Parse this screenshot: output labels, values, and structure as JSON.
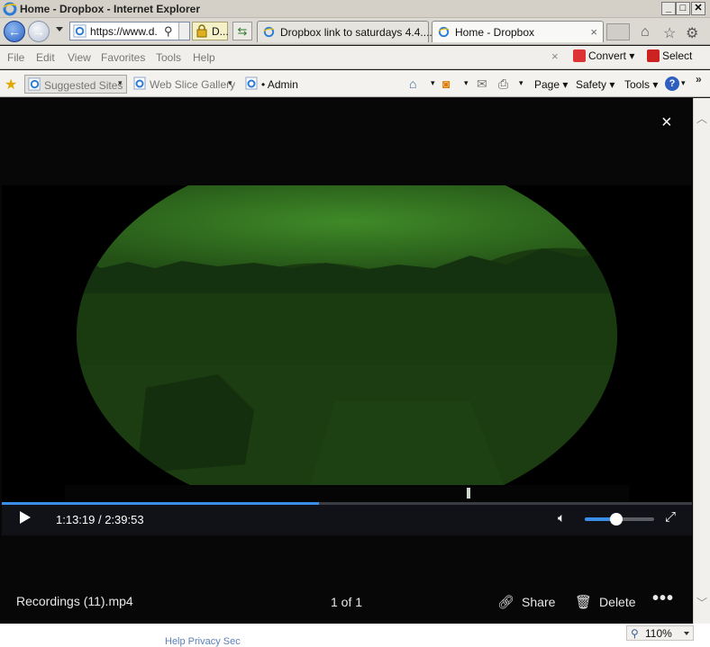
{
  "window": {
    "title": "Home - Dropbox - Internet Explorer",
    "buttons": [
      "_",
      "□",
      "✕"
    ]
  },
  "nav": {
    "url": "https://www.d.",
    "security_text": "D..."
  },
  "tabs": [
    {
      "label": "Dropbox link to saturdays 4.4....",
      "active": false
    },
    {
      "label": "Home - Dropbox",
      "active": true,
      "close": "×"
    }
  ],
  "menu": {
    "items": [
      "File",
      "Edit",
      "View",
      "Favorites",
      "Tools",
      "Help"
    ],
    "close": "×",
    "convert": "Convert",
    "select": "Select"
  },
  "favorites": {
    "suggested": "Suggested Sites",
    "web_slice": "Web Slice Gallery",
    "admin": "• Admin"
  },
  "commands": {
    "page": "Page",
    "safety": "Safety",
    "tools": "Tools",
    "help": "?"
  },
  "viewer": {
    "close": "×",
    "current_time": "1:13:19",
    "duration": "2:39:53",
    "time_display": "1:13:19 / 2:39:53",
    "progress_fraction": 0.459,
    "volume_fraction": 0.45,
    "file_name": "Recordings (11).mp4",
    "page_indicator": "1 of 1",
    "share_label": "Share",
    "delete_label": "Delete",
    "more_label": "•••"
  },
  "status": {
    "zoom": "110%",
    "footer_links": "Help    Privacy    Sec"
  },
  "colors": {
    "accent": "#3a8ee8",
    "viewer_bg": "#070707",
    "night_vision": "#2f6a1c"
  },
  "icons": {
    "play": "play-icon",
    "volume": "volume-icon",
    "fullscreen": "fullscreen-icon",
    "share": "share-icon",
    "delete": "trash-icon",
    "more": "more-icon"
  }
}
